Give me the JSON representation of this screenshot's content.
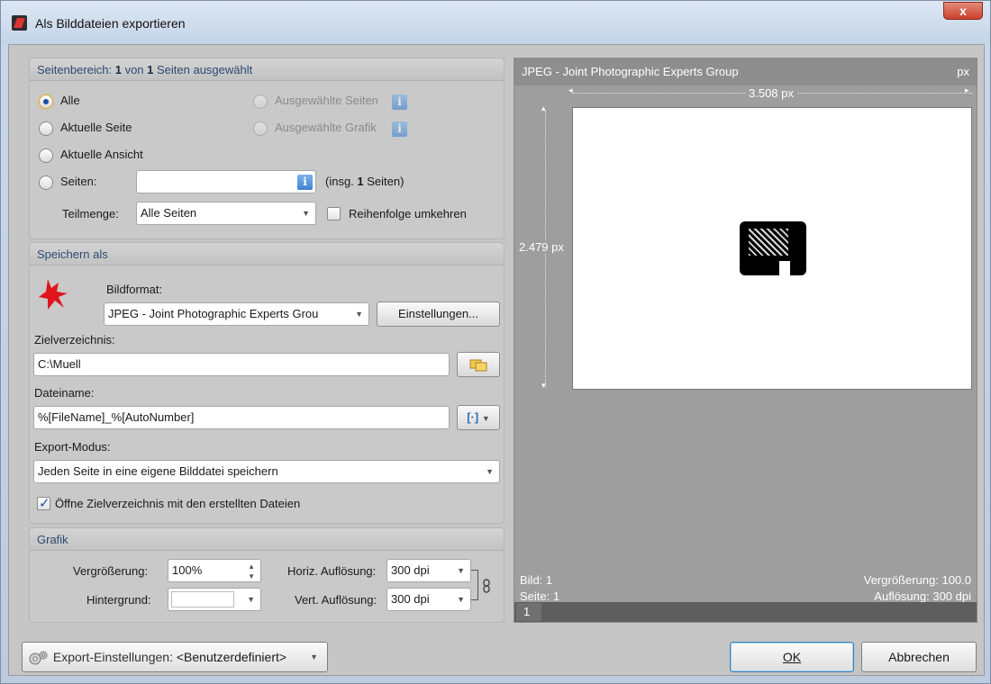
{
  "window": {
    "title": "Als Bilddateien exportieren",
    "close_label": "x"
  },
  "range": {
    "header_prefix": "Seitenbereich: ",
    "header_selected": "1",
    "header_mid": " von ",
    "header_total": "1",
    "header_suffix": " Seiten ausgewählt",
    "options": {
      "all": "Alle",
      "current_page": "Aktuelle Seite",
      "current_view": "Aktuelle Ansicht",
      "pages": "Seiten:",
      "selected_pages": "Ausgewählte Seiten",
      "selected_graphic": "Ausgewählte Grafik"
    },
    "selected_option": "all",
    "pages_value": "",
    "total_pages_prefix": "(insg. ",
    "total_pages_count": "1",
    "total_pages_suffix": " Seiten)",
    "subset_label": "Teilmenge:",
    "subset_value": "Alle Seiten",
    "reverse_order_label": "Reihenfolge umkehren",
    "reverse_order_checked": false
  },
  "save": {
    "header": "Speichern als",
    "format_label": "Bildformat:",
    "format_value": "JPEG - Joint Photographic Experts Grou",
    "settings_button": "Einstellungen...",
    "target_dir_label": "Zielverzeichnis:",
    "target_dir_value": "C:\\Muell",
    "filename_label": "Dateiname:",
    "filename_value": "%[FileName]_%[AutoNumber]",
    "macro_button_label": "[·]",
    "export_mode_label": "Export-Modus:",
    "export_mode_value": "Jeden Seite in eine eigene Bilddatei speichern",
    "open_target_label": "Öffne Zielverzeichnis mit den erstellten Dateien",
    "open_target_checked": true
  },
  "graphic": {
    "header": "Grafik",
    "zoom_label": "Vergrößerung:",
    "zoom_value": "100%",
    "background_label": "Hintergrund:",
    "background_color": "#ffffff",
    "horiz_res_label": "Horiz. Auflösung:",
    "horiz_res_value": "300 dpi",
    "vert_res_label": "Vert. Auflösung:",
    "vert_res_value": "300 dpi"
  },
  "preview": {
    "format_title": "JPEG - Joint Photographic Experts Group",
    "unit": "px",
    "width_label": "3.508 px",
    "height_label": "2.479 px",
    "image_info": "Bild: 1",
    "page_info": "Seite: 1",
    "zoom_info": "Vergrößerung: 100.0",
    "resolution_info": "Auflösung: 300 dpi",
    "page_number": "1"
  },
  "footer": {
    "export_settings_prefix": "Export-Einstellungen: ",
    "export_settings_value": "<Benutzerdefiniert>",
    "ok_button": "OK",
    "cancel_button": "Abbrechen"
  },
  "colors": {
    "accent": "#2c4a72",
    "info_icon": "#3f82d2"
  },
  "icons": [
    "app-icon",
    "close-icon",
    "info-icon",
    "paint-splash-icon",
    "folder-browse-icon",
    "macro-icon",
    "chevron-down-icon",
    "link-chain-icon",
    "gears-icon",
    "checkmark-icon"
  ]
}
